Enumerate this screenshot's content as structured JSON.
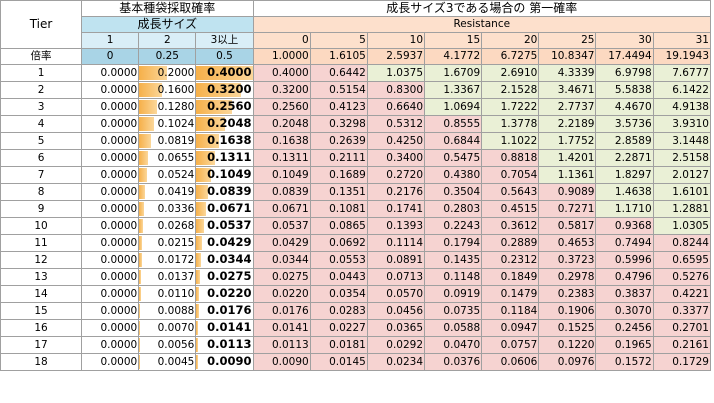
{
  "header": {
    "tier_label": "Tier",
    "base_title": "基本種袋採取確率",
    "result_title": "成長サイズ3である場合の 第一確率",
    "growth_size_label": "成長サイズ",
    "resistance_label": "Resistance",
    "growth_sizes": [
      "1",
      "2",
      "3以上"
    ],
    "resistance_values": [
      "0",
      "5",
      "10",
      "15",
      "20",
      "25",
      "30",
      "31"
    ],
    "factor_label": "倍率",
    "base_factors": [
      "0",
      "0.25",
      "0.5"
    ],
    "resistance_factors": [
      "1.0000",
      "1.6105",
      "2.5937",
      "4.1772",
      "6.7275",
      "10.8347",
      "17.4494",
      "19.1943"
    ]
  },
  "rows": [
    {
      "tier": "1",
      "base": [
        "0.0000",
        "0.2000",
        "0.4000"
      ],
      "res": [
        "0.4000",
        "0.6442",
        "1.0375",
        "1.6709",
        "2.6910",
        "4.3339",
        "6.9798",
        "7.6777"
      ]
    },
    {
      "tier": "2",
      "base": [
        "0.0000",
        "0.1600",
        "0.3200"
      ],
      "res": [
        "0.3200",
        "0.5154",
        "0.8300",
        "1.3367",
        "2.1528",
        "3.4671",
        "5.5838",
        "6.1422"
      ]
    },
    {
      "tier": "3",
      "base": [
        "0.0000",
        "0.1280",
        "0.2560"
      ],
      "res": [
        "0.2560",
        "0.4123",
        "0.6640",
        "1.0694",
        "1.7222",
        "2.7737",
        "4.4670",
        "4.9138"
      ]
    },
    {
      "tier": "4",
      "base": [
        "0.0000",
        "0.1024",
        "0.2048"
      ],
      "res": [
        "0.2048",
        "0.3298",
        "0.5312",
        "0.8555",
        "1.3778",
        "2.2189",
        "3.5736",
        "3.9310"
      ]
    },
    {
      "tier": "5",
      "base": [
        "0.0000",
        "0.0819",
        "0.1638"
      ],
      "res": [
        "0.1638",
        "0.2639",
        "0.4250",
        "0.6844",
        "1.1022",
        "1.7752",
        "2.8589",
        "3.1448"
      ]
    },
    {
      "tier": "6",
      "base": [
        "0.0000",
        "0.0655",
        "0.1311"
      ],
      "res": [
        "0.1311",
        "0.2111",
        "0.3400",
        "0.5475",
        "0.8818",
        "1.4201",
        "2.2871",
        "2.5158"
      ]
    },
    {
      "tier": "7",
      "base": [
        "0.0000",
        "0.0524",
        "0.1049"
      ],
      "res": [
        "0.1049",
        "0.1689",
        "0.2720",
        "0.4380",
        "0.7054",
        "1.1361",
        "1.8297",
        "2.0127"
      ]
    },
    {
      "tier": "8",
      "base": [
        "0.0000",
        "0.0419",
        "0.0839"
      ],
      "res": [
        "0.0839",
        "0.1351",
        "0.2176",
        "0.3504",
        "0.5643",
        "0.9089",
        "1.4638",
        "1.6101"
      ]
    },
    {
      "tier": "9",
      "base": [
        "0.0000",
        "0.0336",
        "0.0671"
      ],
      "res": [
        "0.0671",
        "0.1081",
        "0.1741",
        "0.2803",
        "0.4515",
        "0.7271",
        "1.1710",
        "1.2881"
      ]
    },
    {
      "tier": "10",
      "base": [
        "0.0000",
        "0.0268",
        "0.0537"
      ],
      "res": [
        "0.0537",
        "0.0865",
        "0.1393",
        "0.2243",
        "0.3612",
        "0.5817",
        "0.9368",
        "1.0305"
      ]
    },
    {
      "tier": "11",
      "base": [
        "0.0000",
        "0.0215",
        "0.0429"
      ],
      "res": [
        "0.0429",
        "0.0692",
        "0.1114",
        "0.1794",
        "0.2889",
        "0.4653",
        "0.7494",
        "0.8244"
      ]
    },
    {
      "tier": "12",
      "base": [
        "0.0000",
        "0.0172",
        "0.0344"
      ],
      "res": [
        "0.0344",
        "0.0553",
        "0.0891",
        "0.1435",
        "0.2312",
        "0.3723",
        "0.5996",
        "0.6595"
      ]
    },
    {
      "tier": "13",
      "base": [
        "0.0000",
        "0.0137",
        "0.0275"
      ],
      "res": [
        "0.0275",
        "0.0443",
        "0.0713",
        "0.1148",
        "0.1849",
        "0.2978",
        "0.4796",
        "0.5276"
      ]
    },
    {
      "tier": "14",
      "base": [
        "0.0000",
        "0.0110",
        "0.0220"
      ],
      "res": [
        "0.0220",
        "0.0354",
        "0.0570",
        "0.0919",
        "0.1479",
        "0.2383",
        "0.3837",
        "0.4221"
      ]
    },
    {
      "tier": "15",
      "base": [
        "0.0000",
        "0.0088",
        "0.0176"
      ],
      "res": [
        "0.0176",
        "0.0283",
        "0.0456",
        "0.0735",
        "0.1184",
        "0.1906",
        "0.3070",
        "0.3377"
      ]
    },
    {
      "tier": "16",
      "base": [
        "0.0000",
        "0.0070",
        "0.0141"
      ],
      "res": [
        "0.0141",
        "0.0227",
        "0.0365",
        "0.0588",
        "0.0947",
        "0.1525",
        "0.2456",
        "0.2701"
      ]
    },
    {
      "tier": "17",
      "base": [
        "0.0000",
        "0.0056",
        "0.0113"
      ],
      "res": [
        "0.0113",
        "0.0181",
        "0.0292",
        "0.0470",
        "0.0757",
        "0.1220",
        "0.1965",
        "0.2161"
      ]
    },
    {
      "tier": "18",
      "base": [
        "0.0000",
        "0.0045",
        "0.0090"
      ],
      "res": [
        "0.0090",
        "0.0145",
        "0.0234",
        "0.0376",
        "0.0606",
        "0.0976",
        "0.1572",
        "0.1729"
      ]
    }
  ],
  "colors": {
    "bar_orange": "#f6b04a",
    "header_blue": "#bfe3f0",
    "header_peach": "#fde0cc",
    "heat_pink": "#f6d3d1",
    "heat_green": "#eaf0d6"
  }
}
